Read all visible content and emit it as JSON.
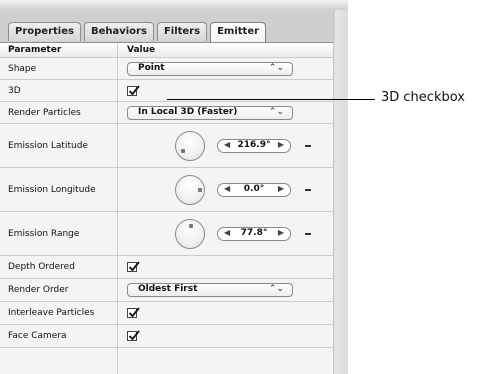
{
  "tabs": [
    "Properties",
    "Behaviors",
    "Filters",
    "Emitter"
  ],
  "active_tab": "Emitter",
  "table": {
    "header_param": "Parameter",
    "header_value": "Value",
    "rows": [
      {
        "label": "Shape",
        "popup": "Point"
      },
      {
        "label": "3D",
        "checked": true
      },
      {
        "label": "Render Particles",
        "popup": "In Local 3D (Faster)"
      },
      {
        "label": "Emission Latitude",
        "value": "216.9°"
      },
      {
        "label": "Emission Longitude",
        "value": "0.0°"
      },
      {
        "label": "Emission Range",
        "value": "77.8°"
      },
      {
        "label": "Depth Ordered",
        "checked": true
      },
      {
        "label": "Render Order",
        "popup": "Oldest First"
      },
      {
        "label": "Interleave Particles",
        "checked": true
      },
      {
        "label": "Face Camera",
        "checked": true
      }
    ]
  },
  "icons": {
    "popup_arrows": "⌃⌄",
    "stepper_left": "◀",
    "stepper_right": "▶"
  },
  "callout": {
    "text": "3D checkbox"
  }
}
